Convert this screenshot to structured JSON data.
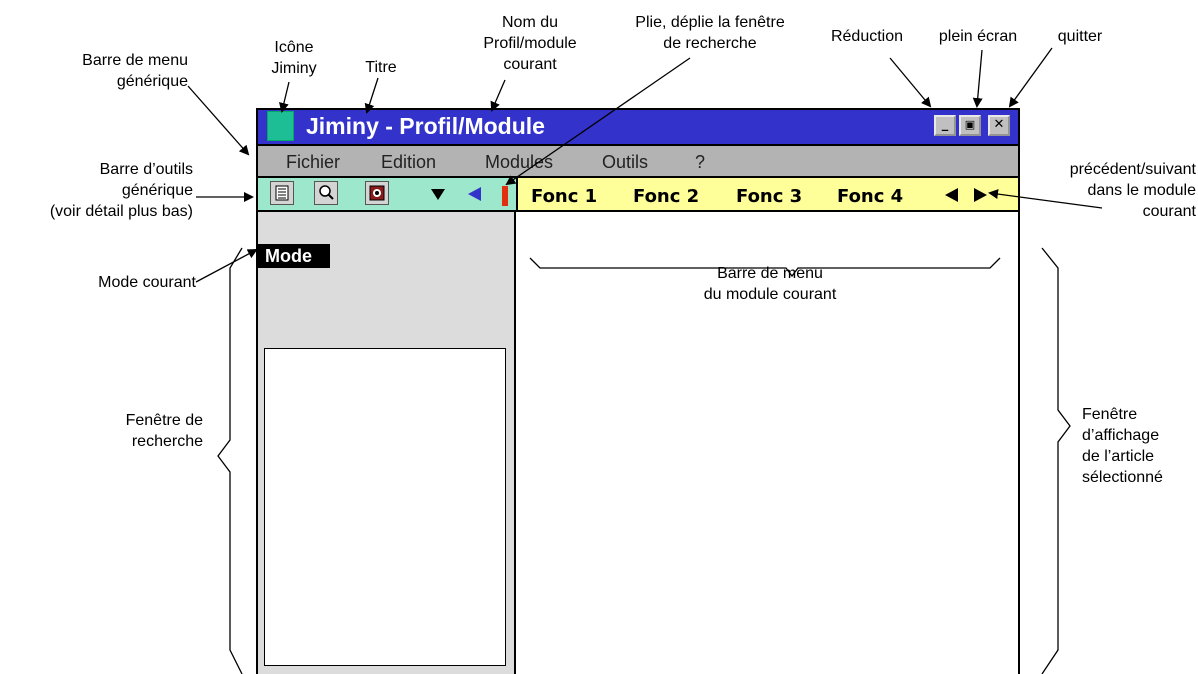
{
  "window": {
    "title": "Jiminy - Profil/Module",
    "controls": {
      "minimize": "_",
      "restore": "🗗",
      "close": "✕"
    }
  },
  "menubar": {
    "items": [
      "Fichier",
      "Edition",
      "Modules",
      "Outils",
      "?"
    ]
  },
  "toolbar": {
    "icons": [
      "list-icon",
      "search-icon",
      "image-icon",
      "dropdown-arrow-icon",
      "collapse-arrow-icon"
    ],
    "functions": [
      "Fonc 1",
      "Fonc 2",
      "Fonc 3",
      "Fonc 4"
    ],
    "nav": {
      "prev": "◀",
      "next": "▶"
    }
  },
  "search_pane": {
    "mode_label": "Mode"
  },
  "annotations": {
    "barre_menu_generique": [
      "Barre de menu",
      "générique"
    ],
    "icone_jiminy": [
      "Icône",
      "Jiminy"
    ],
    "titre": "Titre",
    "nom_profil": [
      "Nom du",
      "Profil/module",
      "courant"
    ],
    "plie_deplie": [
      "Plie, déplie la fenêtre",
      "de recherche"
    ],
    "reduction": "Réduction",
    "plein_ecran": "plein écran",
    "quitter": "quitter",
    "barre_outils": [
      "Barre d’outils",
      "générique",
      "(voir détail plus bas)"
    ],
    "precedent_suivant": [
      "précédent/suivant",
      "dans le module",
      "courant"
    ],
    "mode_courant": "Mode courant",
    "barre_menu_module": [
      "Barre de menu",
      "du module courant"
    ],
    "fenetre_recherche": [
      "Fenêtre de",
      "recherche"
    ],
    "fenetre_affichage": [
      "Fenêtre",
      "d’affichage",
      "de l’article",
      "sélectionné"
    ]
  },
  "colors": {
    "titlebar": "#3333cc",
    "app_icon": "#1dbe96",
    "menubar": "#b3b3b3",
    "toolbar_left": "#9de8cc",
    "toolbar_right": "#ffff99",
    "search_pane": "#dcdcdc",
    "nav_blue": "#3333cc",
    "splitter_red": "#e03010"
  }
}
